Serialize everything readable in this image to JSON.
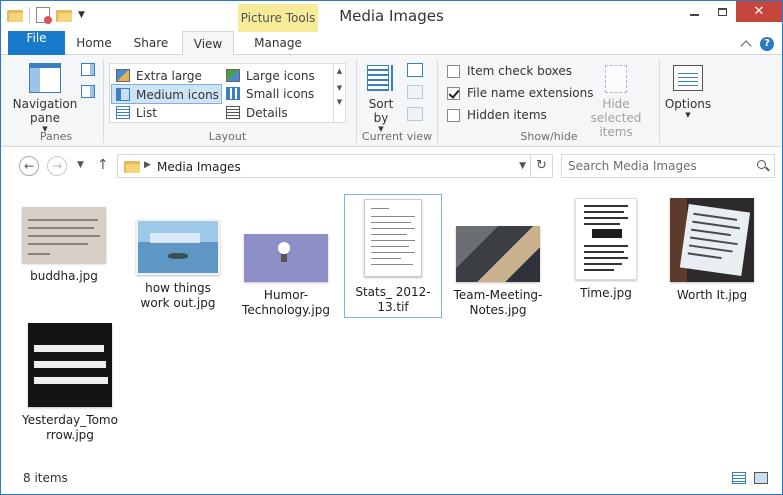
{
  "window": {
    "title": "Media Images",
    "contextual_tab_group": "Picture Tools",
    "controls": {
      "minimize": "minimize",
      "maximize": "maximize",
      "close": "close"
    }
  },
  "tabs": [
    {
      "label": "File",
      "selected": false
    },
    {
      "label": "Home",
      "selected": false
    },
    {
      "label": "Share",
      "selected": false
    },
    {
      "label": "View",
      "selected": true
    },
    {
      "label": "Manage",
      "selected": false
    }
  ],
  "ribbon": {
    "panes": {
      "group_label": "Panes",
      "navigation_pane": "Navigation pane"
    },
    "layout": {
      "group_label": "Layout",
      "items": [
        {
          "label": "Extra large icons",
          "icon": "extra-large-icons-icon"
        },
        {
          "label": "Large icons",
          "icon": "large-icons-icon"
        },
        {
          "label": "Medium icons",
          "icon": "medium-icons-icon",
          "selected": true
        },
        {
          "label": "Small icons",
          "icon": "small-icons-icon"
        },
        {
          "label": "List",
          "icon": "list-icon"
        },
        {
          "label": "Details",
          "icon": "details-icon"
        }
      ]
    },
    "current_view": {
      "group_label": "Current view",
      "sort_by": "Sort by"
    },
    "show_hide": {
      "group_label": "Show/hide",
      "item_check_boxes": {
        "label": "Item check boxes",
        "checked": false
      },
      "file_name_extensions": {
        "label": "File name extensions",
        "checked": true
      },
      "hidden_items": {
        "label": "Hidden items",
        "checked": false
      },
      "hide_selected_items": "Hide selected items"
    },
    "options": {
      "label": "Options"
    }
  },
  "address": {
    "breadcrumb": "Media Images",
    "search_placeholder": "Search Media Images"
  },
  "files": [
    {
      "name": "buddha.jpg"
    },
    {
      "name": "how things work out.jpg"
    },
    {
      "name": "Humor-Technology.jpg"
    },
    {
      "name": "Stats_ 2012-13.tif",
      "selected": true
    },
    {
      "name": "Team-Meeting-Notes.jpg"
    },
    {
      "name": "Time.jpg"
    },
    {
      "name": "Worth It.jpg"
    },
    {
      "name": "Yesterday_Tomorrow.jpg"
    }
  ],
  "status": {
    "item_count": "8 items"
  },
  "colors": {
    "accent": "#1979ca",
    "contextual": "#f7eb9a",
    "close": "#c7463b",
    "selection": "#cde4f7"
  }
}
